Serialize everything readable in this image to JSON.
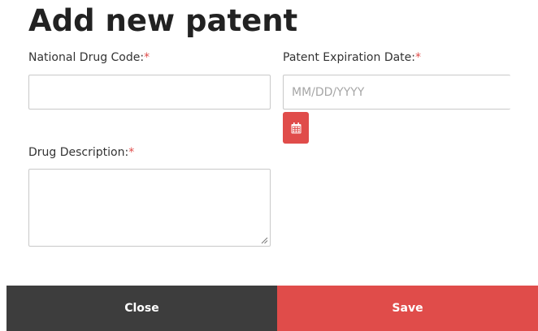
{
  "modal": {
    "title": "Add new patent",
    "required_marker": "*",
    "fields": {
      "ndc": {
        "label": "National Drug Code:",
        "value": "",
        "placeholder": ""
      },
      "expiration": {
        "label": "Patent Expiration Date:",
        "value": "",
        "placeholder": "MM/DD/YYYY"
      },
      "description": {
        "label": "Drug Description:",
        "value": "",
        "placeholder": ""
      }
    },
    "calendar_icon": "calendar-icon",
    "buttons": {
      "close_label": "Close",
      "save_label": "Save"
    }
  },
  "colors": {
    "accent": "#e04c4a",
    "dark_button": "#3d3d3d",
    "border": "#c9c9c9",
    "title": "#222222"
  }
}
